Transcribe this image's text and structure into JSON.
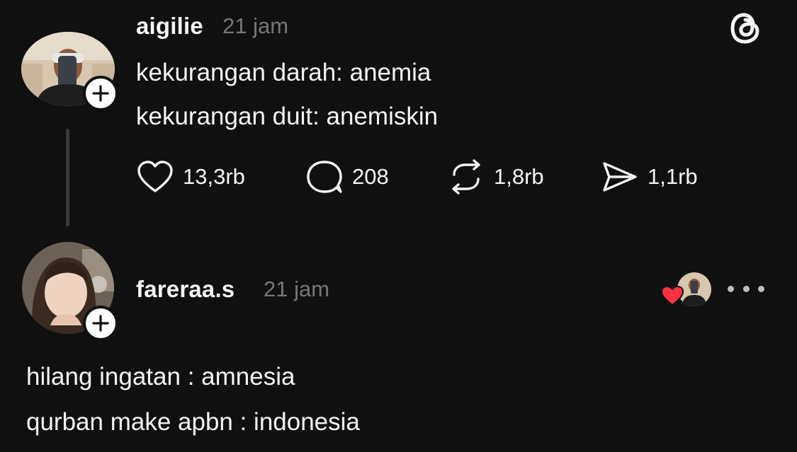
{
  "app": {
    "logo_icon": "threads-logo-icon"
  },
  "colors": {
    "background": "#101010",
    "text": "#f3f5f7",
    "muted": "#777777",
    "heart": "#ff3040"
  },
  "post": {
    "username": "aigilie",
    "time": "21 jam",
    "lines": [
      "kekurangan darah: anemia",
      "kekurangan duit: anemiskin"
    ],
    "actions": {
      "like_count": "13,3rb",
      "reply_count": "208",
      "repost_count": "1,8rb",
      "share_count": "1,1rb"
    }
  },
  "reply": {
    "username": "fareraa.s",
    "time": "21 jam",
    "lines": [
      "hilang ingatan : amnesia",
      "qurban make apbn : indonesia"
    ]
  }
}
